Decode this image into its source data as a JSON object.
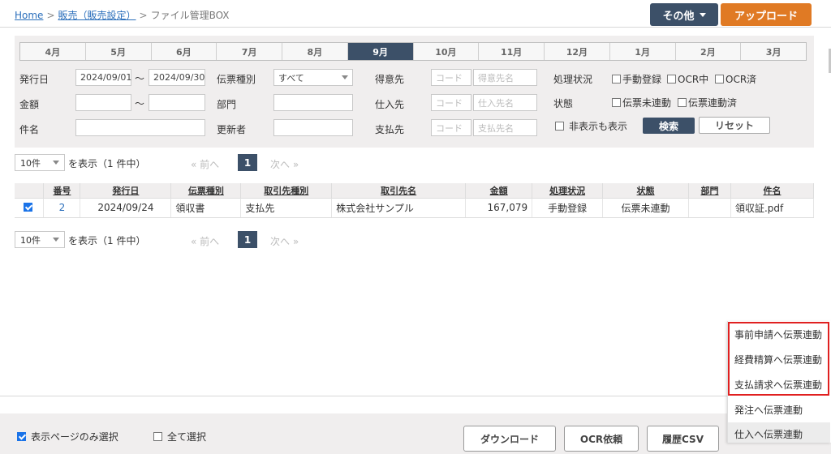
{
  "breadcrumb": {
    "home": "Home",
    "sep": ">",
    "sales": "販売（販売設定）",
    "current": "ファイル管理BOX"
  },
  "header": {
    "other_label": "その他",
    "upload_label": "アップロード"
  },
  "months": {
    "items": [
      "4月",
      "5月",
      "6月",
      "7月",
      "8月",
      "9月",
      "10月",
      "11月",
      "12月",
      "1月",
      "2月",
      "3月"
    ],
    "active": "9月"
  },
  "search": {
    "issue_date_label": "発行日",
    "date_from": "2024/09/01",
    "tilde": "〜",
    "date_to": "2024/09/30",
    "slip_type_label": "伝票種別",
    "slip_type_value": "すべて",
    "customer_label": "得意先",
    "code_placeholder": "コード",
    "customer_name_placeholder": "得意先名",
    "process_status_label": "処理状況",
    "manual_label": "手動登録",
    "ocr_in_progress_label": "OCR中",
    "ocr_done_label": "OCR済",
    "amount_label": "金額",
    "department_label": "部門",
    "supplier_label": "仕入先",
    "supplier_name_placeholder": "仕入先名",
    "status_label": "状態",
    "not_linked_label": "伝票未連動",
    "linked_label": "伝票連動済",
    "subject_label": "件名",
    "updater_label": "更新者",
    "payee_label": "支払先",
    "payee_name_placeholder": "支払先名",
    "show_hidden_label": "非表示も表示",
    "search_button": "検索",
    "reset_button": "リセット"
  },
  "pager": {
    "per_page": "10件",
    "display_text": "を表示（1 件中）",
    "prev": "« 前へ",
    "current": "1",
    "next": "次へ »"
  },
  "table": {
    "headers": [
      "番号",
      "発行日",
      "伝票種別",
      "取引先種別",
      "取引先名",
      "金額",
      "処理状況",
      "状態",
      "部門",
      "件名"
    ],
    "rows": [
      {
        "no": "2",
        "date": "2024/09/24",
        "slip_type": "領収書",
        "partner_type": "支払先",
        "partner_name": "株式会社サンプル",
        "amount": "167,079",
        "process": "手動登録",
        "status": "伝票未連動",
        "dept": "",
        "subject": "領収証.pdf"
      }
    ]
  },
  "footer": {
    "page_only_label": "表示ページのみ選択",
    "select_all_label": "全て選択",
    "download_button": "ダウンロード",
    "ocr_button": "OCR依頼",
    "history_button": "履歴CSV"
  },
  "menu": {
    "items": [
      "事前申請へ伝票連動",
      "経費精算へ伝票連動",
      "支払請求へ伝票連動",
      "発注へ伝票連動",
      "仕入へ伝票連動"
    ]
  },
  "colors": {
    "primary": "#3c5068",
    "accent": "#e07a24",
    "link": "#2a6ebb",
    "highlight": "#e02020"
  }
}
